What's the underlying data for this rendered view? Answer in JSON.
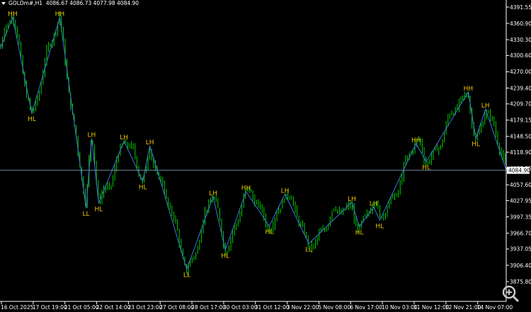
{
  "header": {
    "symbol": "GOLDm#,H1",
    "ohlc": "4086.67 4086.73 4077.98 4084.90"
  },
  "icons": {
    "zoom": "zoom-in-icon",
    "dropdown": "triangle-down-icon"
  },
  "colors": {
    "background": "#000000",
    "candle": "#00d000",
    "zigzag": "#3c78d8",
    "label": "#e8c200",
    "text": "#ffffff",
    "price_line": "#7a9ab5"
  },
  "chart_data": {
    "type": "line",
    "price_axis": {
      "ticks": [
        "4391.55",
        "4360.90",
        "4330.30",
        "4300.60",
        "4270.00",
        "4239.40",
        "4209.70",
        "4179.15",
        "4148.50",
        "4118.90",
        "4088.25",
        "4057.60",
        "4027.95",
        "3997.35",
        "3966.70",
        "3937.05",
        "3906.40",
        "3875.80"
      ],
      "ylim": [
        3875.8,
        4391.55
      ]
    },
    "time_axis": {
      "ticks": [
        "16 Oct 2025",
        "17 Oct 19:00",
        "21 Oct 05:00",
        "22 Oct 14:00",
        "23 Oct 23:00",
        "27 Oct 08:00",
        "28 Oct 17:00",
        "30 Oct 03:00",
        "31 Oct 12:00",
        "3 Nov 22:00",
        "5 Nov 08:00",
        "6 Nov 17:00",
        "10 Nov 03:00",
        "11 Nov 12:00",
        "12 Nov 21:00",
        "14 Nov 07:00"
      ]
    },
    "current_price": "4084.90",
    "swings": [
      {
        "label": "HH",
        "t": 0.025,
        "price": 4372
      },
      {
        "label": "HL",
        "t": 0.063,
        "price": 4192
      },
      {
        "label": "HH",
        "t": 0.118,
        "price": 4372
      },
      {
        "label": "LL",
        "t": 0.17,
        "price": 4014
      },
      {
        "label": "LH",
        "t": 0.181,
        "price": 4145
      },
      {
        "label": "HL",
        "t": 0.195,
        "price": 4023
      },
      {
        "label": "LH",
        "t": 0.245,
        "price": 4140
      },
      {
        "label": "HL",
        "t": 0.282,
        "price": 4064
      },
      {
        "label": "LH",
        "t": 0.296,
        "price": 4131
      },
      {
        "label": "LL",
        "t": 0.369,
        "price": 3899
      },
      {
        "label": "LH",
        "t": 0.421,
        "price": 4035
      },
      {
        "label": "HL",
        "t": 0.445,
        "price": 3935
      },
      {
        "label": "HH",
        "t": 0.486,
        "price": 4045
      },
      {
        "label": "HL",
        "t": 0.532,
        "price": 3980
      },
      {
        "label": "LH",
        "t": 0.563,
        "price": 4040
      },
      {
        "label": "LL",
        "t": 0.61,
        "price": 3947
      },
      {
        "label": "LH",
        "t": 0.695,
        "price": 4025
      },
      {
        "label": "HL",
        "t": 0.71,
        "price": 3979
      },
      {
        "label": "LH",
        "t": 0.738,
        "price": 4016
      },
      {
        "label": "HL",
        "t": 0.75,
        "price": 3991
      },
      {
        "label": "HH",
        "t": 0.822,
        "price": 4135
      },
      {
        "label": "HL",
        "t": 0.842,
        "price": 4101
      },
      {
        "label": "HH",
        "t": 0.925,
        "price": 4232
      },
      {
        "label": "HL",
        "t": 0.94,
        "price": 4145
      },
      {
        "label": "LH",
        "t": 0.959,
        "price": 4200
      }
    ]
  }
}
